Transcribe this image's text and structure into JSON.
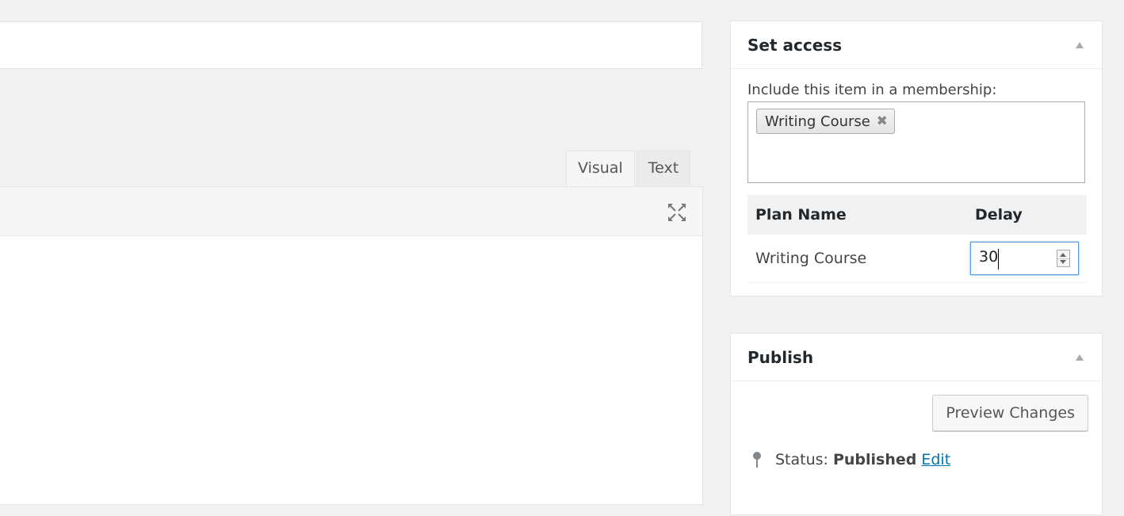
{
  "editor": {
    "tabs": [
      {
        "label": "Visual",
        "active": true
      },
      {
        "label": "Text",
        "active": false
      }
    ],
    "fullscreen_icon": "expand-icon"
  },
  "set_access": {
    "title": "Set access",
    "include_label": "Include this item in a membership:",
    "selected_memberships": [
      "Writing Course"
    ],
    "table": {
      "columns": [
        "Plan Name",
        "Delay"
      ],
      "rows": [
        {
          "plan_name": "Writing Course",
          "delay": "30"
        }
      ]
    }
  },
  "publish": {
    "title": "Publish",
    "preview_button": "Preview Changes",
    "status_label": "Status:",
    "status_value": "Published",
    "status_edit": "Edit"
  },
  "colors": {
    "background": "#f1f1f1",
    "link": "#0073aa",
    "focus": "#5b9dd9"
  }
}
